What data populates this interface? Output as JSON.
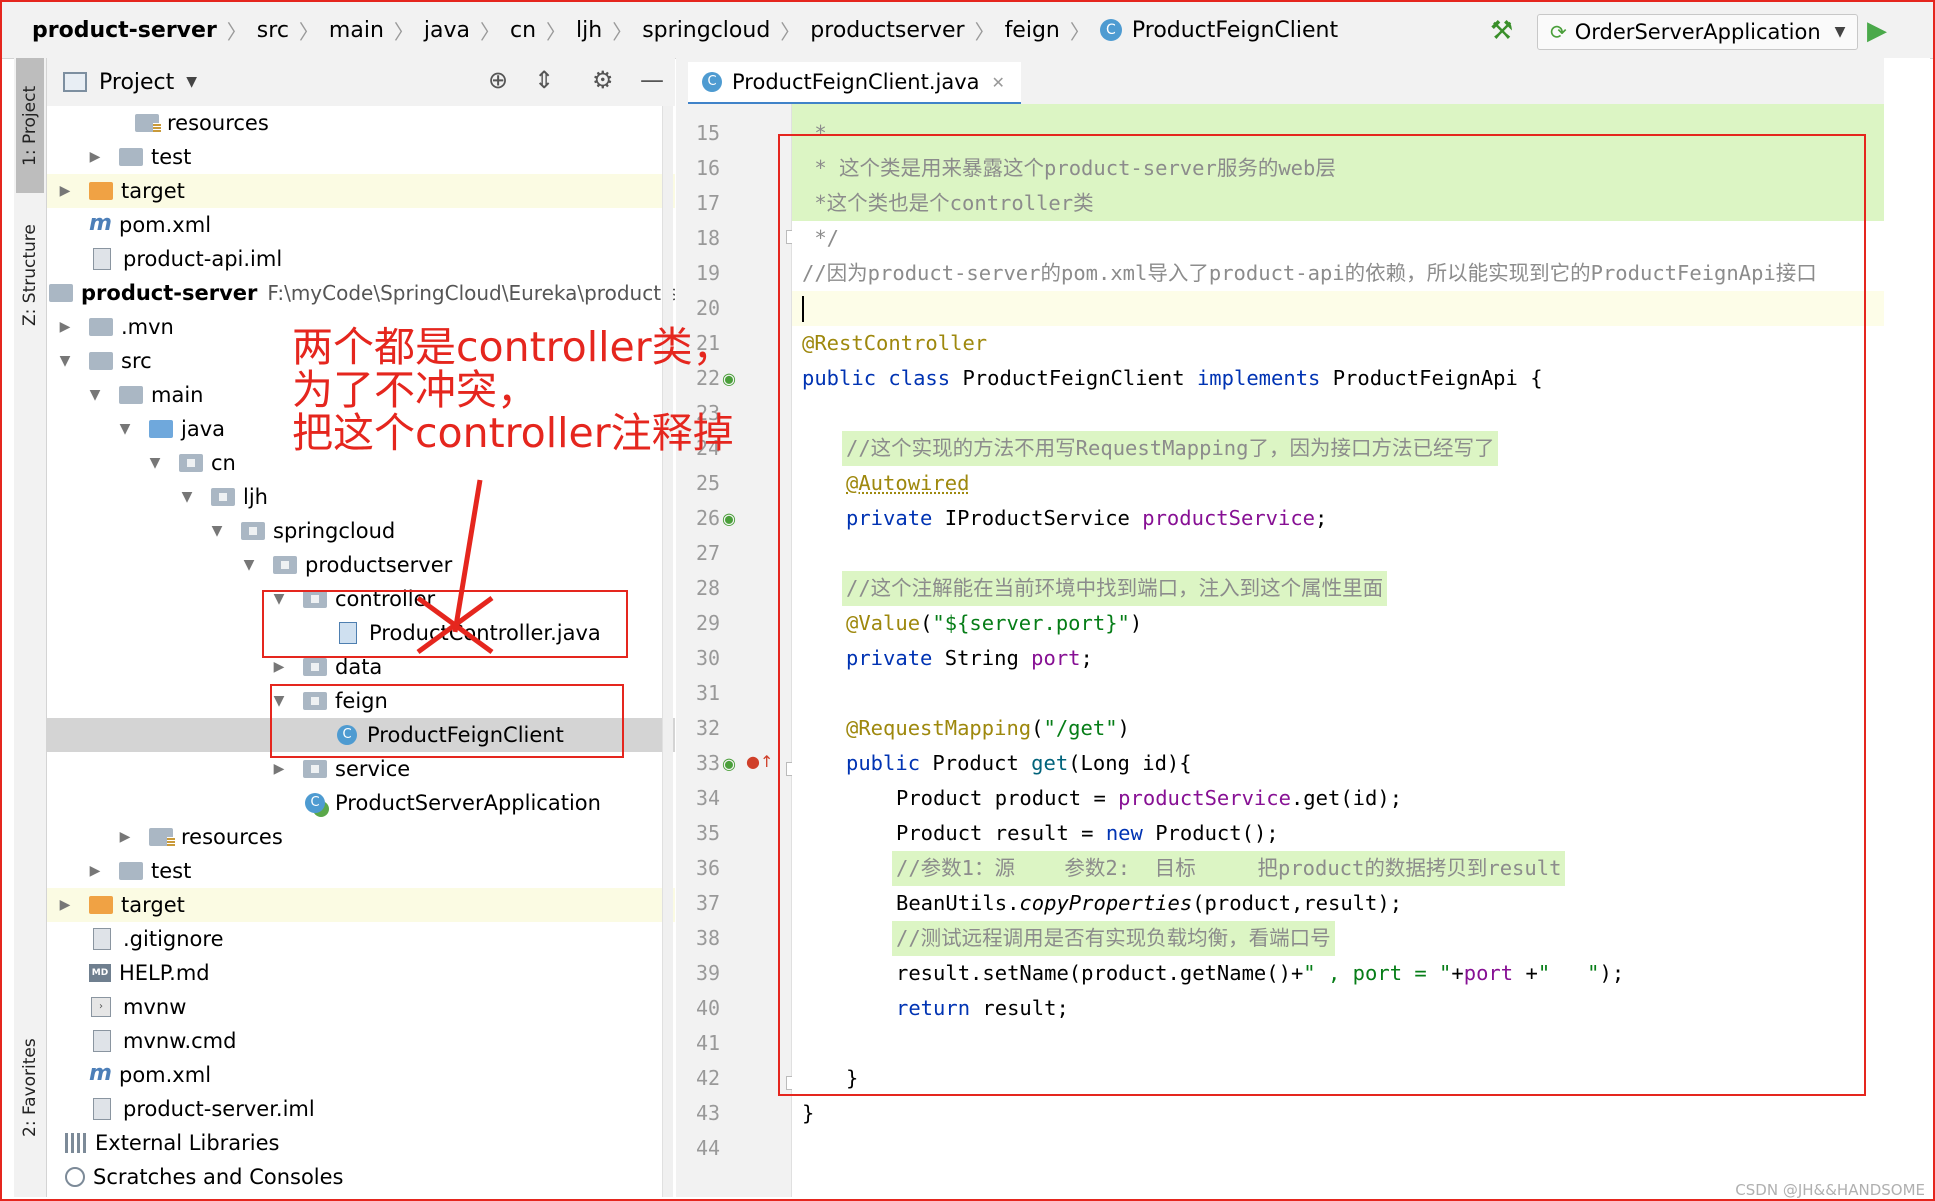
{
  "breadcrumb": {
    "items": [
      "product-server",
      "src",
      "main",
      "java",
      "cn",
      "ljh",
      "springcloud",
      "productserver",
      "feign",
      "ProductFeignClient"
    ],
    "class_icon": "C"
  },
  "toolbar": {
    "run_config": "OrderServerApplication",
    "build_icon": "hammer-icon",
    "run_icon": "run-icon"
  },
  "side_tabs": {
    "project": "1: Project",
    "structure": "Z: Structure",
    "favorites": "2: Favorites"
  },
  "project_panel": {
    "title": "Project",
    "tree": [
      {
        "label": "resources",
        "icon": "resources-folder"
      },
      {
        "label": "test",
        "icon": "folder"
      },
      {
        "label": "target",
        "icon": "folder-orange"
      },
      {
        "label": "pom.xml",
        "icon": "maven-file"
      },
      {
        "label": "product-api.iml",
        "icon": "iml-file"
      },
      {
        "label": "product-server",
        "icon": "module-folder",
        "path": "F:\\myCode\\SpringCloud\\Eureka\\product-ser"
      },
      {
        "label": ".mvn",
        "icon": "folder"
      },
      {
        "label": "src",
        "icon": "folder"
      },
      {
        "label": "main",
        "icon": "folder"
      },
      {
        "label": "java",
        "icon": "folder-blue"
      },
      {
        "label": "cn",
        "icon": "package"
      },
      {
        "label": "ljh",
        "icon": "package"
      },
      {
        "label": "springcloud",
        "icon": "package"
      },
      {
        "label": "productserver",
        "icon": "package"
      },
      {
        "label": "controller",
        "icon": "package"
      },
      {
        "label": "ProductController.java",
        "icon": "java-file"
      },
      {
        "label": "data",
        "icon": "package"
      },
      {
        "label": "feign",
        "icon": "package"
      },
      {
        "label": "ProductFeignClient",
        "icon": "class"
      },
      {
        "label": "service",
        "icon": "package"
      },
      {
        "label": "ProductServerApplication",
        "icon": "app-class"
      },
      {
        "label": "resources",
        "icon": "resources-folder"
      },
      {
        "label": "test",
        "icon": "folder"
      },
      {
        "label": "target",
        "icon": "folder-orange"
      },
      {
        "label": ".gitignore",
        "icon": "ignore-file"
      },
      {
        "label": "HELP.md",
        "icon": "md-file"
      },
      {
        "label": "mvnw",
        "icon": "script-file"
      },
      {
        "label": "mvnw.cmd",
        "icon": "cmd-file"
      },
      {
        "label": "pom.xml",
        "icon": "maven-file"
      },
      {
        "label": "product-server.iml",
        "icon": "iml-file"
      },
      {
        "label": "External Libraries",
        "icon": "library"
      },
      {
        "label": "Scratches and Consoles",
        "icon": "scratch"
      }
    ]
  },
  "editor": {
    "tab_label": "ProductFeignClient.java",
    "line_numbers": [
      "15",
      "16",
      "17",
      "18",
      "19",
      "20",
      "21",
      "22",
      "23",
      "24",
      "25",
      "26",
      "27",
      "28",
      "29",
      "30",
      "31",
      "32",
      "33",
      "34",
      "35",
      "36",
      "37",
      "38",
      "39",
      "40",
      "41",
      "42",
      "43",
      "44"
    ],
    "code": {
      "l15": " *",
      "l16": " * 这个类是用来暴露这个product-server服务的web层",
      "l17": " *这个类也是个controller类",
      "l18": " */",
      "l19": "//因为product-server的pom.xml导入了product-api的依赖，所以能实现到它的ProductFeignApi接口",
      "l21": "@RestController",
      "l22_kw": "public class ",
      "l22_name": "ProductFeignClient ",
      "l22_impl": "implements ",
      "l22_rest": "ProductFeignApi {",
      "l24": "//这个实现的方法不用写RequestMapping了，因为接口方法已经写了",
      "l25": "@Autowired",
      "l26_kw": "private ",
      "l26_type": "IProductService ",
      "l26_field": "productService",
      "l26_end": ";",
      "l28": "//这个注解能在当前环境中找到端口，注入到这个属性里面",
      "l29_an": "@Value",
      "l29_p1": "(",
      "l29_str": "\"${server.port}\"",
      "l29_p2": ")",
      "l30_kw": "private ",
      "l30_type": "String ",
      "l30_field": "port",
      "l30_end": ";",
      "l32_an": "@RequestMapping",
      "l32_p1": "(",
      "l32_str": "\"/get\"",
      "l32_p2": ")",
      "l33_kw": "public ",
      "l33_type": "Product ",
      "l33_m": "get",
      "l33_rest": "(Long id){",
      "l34_a": "Product product = ",
      "l34_f": "productService",
      "l34_b": ".get(id);",
      "l35_a": "Product result = ",
      "l35_kw": "new ",
      "l35_b": "Product();",
      "l36": "//参数1：源    参数2:  目标     把product的数据拷贝到result",
      "l37_a": "BeanUtils.",
      "l37_it": "copyProperties",
      "l37_b": "(product,result);",
      "l38": "//测试远程调用是否有实现负载均衡，看端口号",
      "l39_a": "result.setName(product.getName()+",
      "l39_s1": "\" , port = \"",
      "l39_b": "+",
      "l39_f": "port",
      "l39_c": " +",
      "l39_s2": "\"   \"",
      "l39_d": ");",
      "l40_kw": "return ",
      "l40_b": "result;",
      "l42": "}",
      "l43": "}"
    }
  },
  "annotation": {
    "note": "两个都是controller类，\n为了不冲突，\n把这个controller注释掉",
    "color": "#e5261e"
  },
  "watermark": "CSDN @JH&&HANDSOME"
}
